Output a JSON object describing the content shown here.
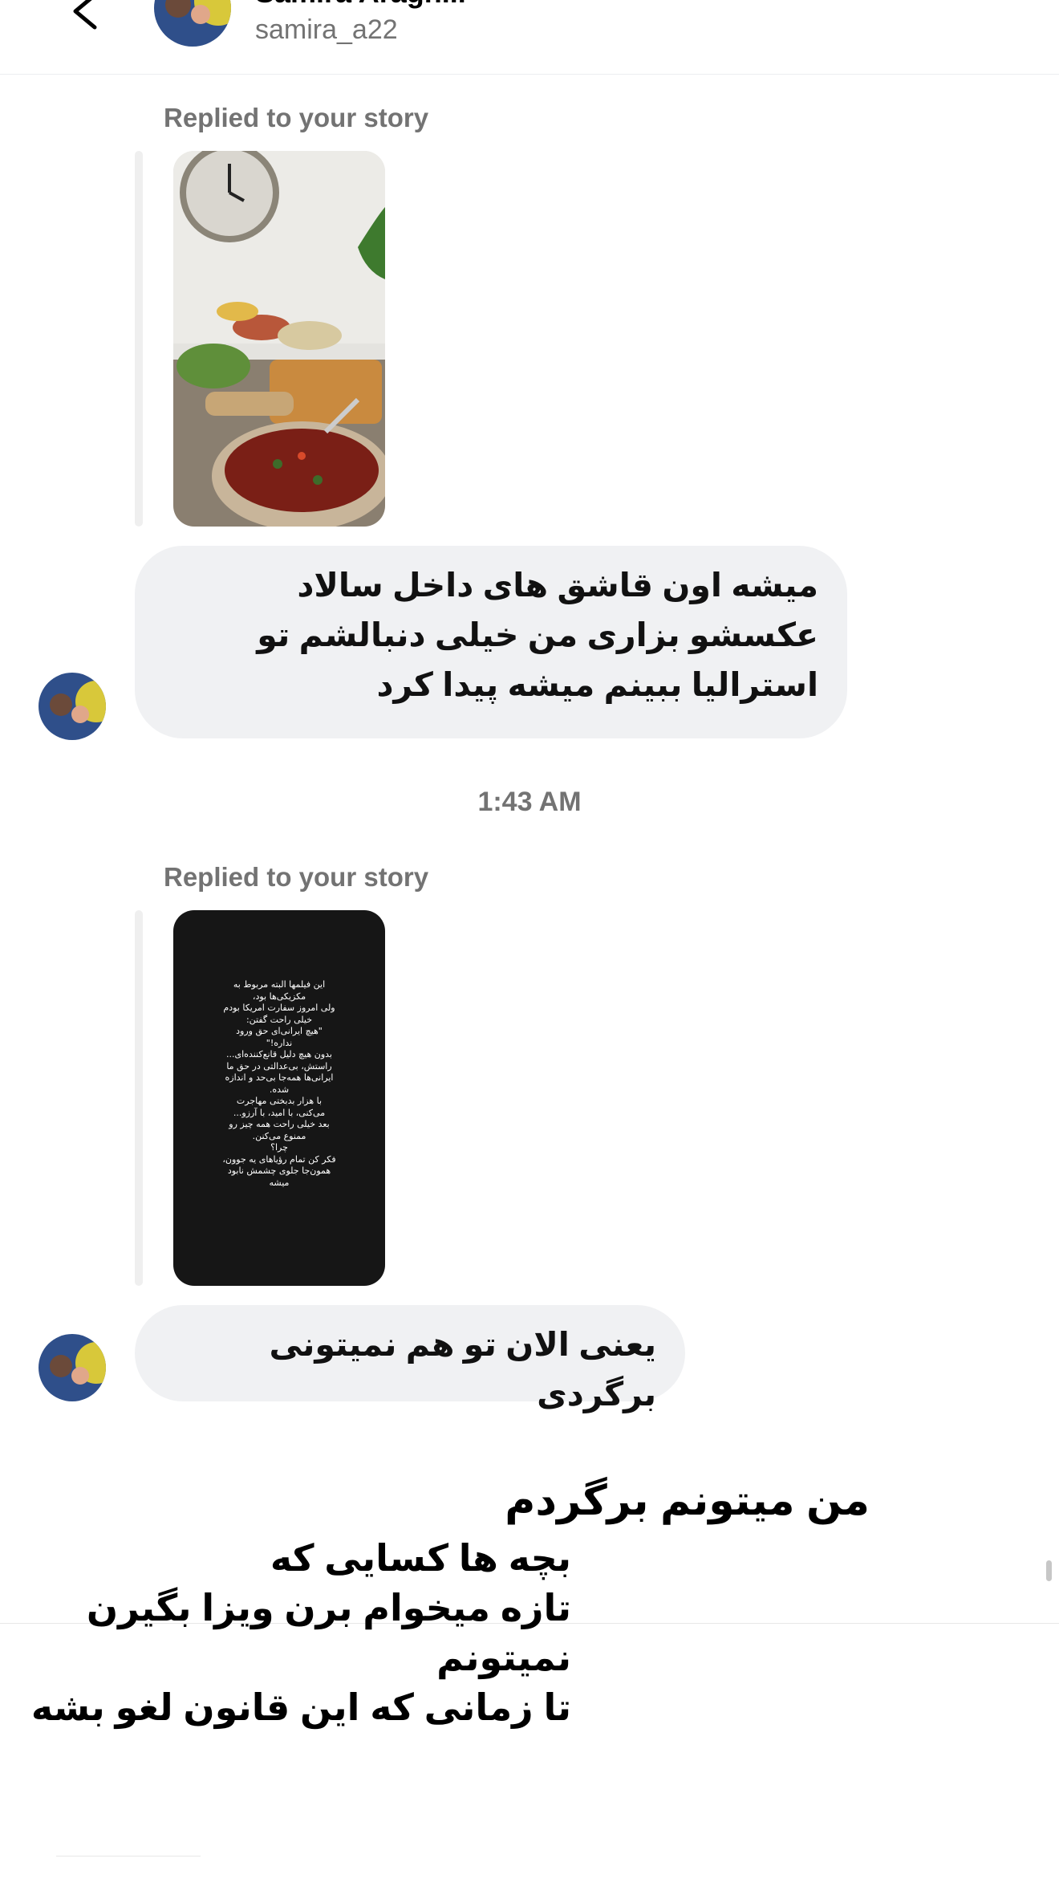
{
  "header": {
    "name": "Samira Aragh...",
    "username": "samira_a22"
  },
  "messages": [
    {
      "replied_label": "Replied to your story",
      "text": "میشه اون قاشق های داخل سالاد عکسشو بزاری من خیلی دنبالشم تو استرالیا ببینم میشه پیدا کرد"
    },
    {
      "replied_label": "Replied to your story",
      "text": "یعنی الان تو هم نمیتونی برگردی"
    }
  ],
  "timestamp": "1:43 AM",
  "story2_text": [
    "این فیلمها البته مربوط به",
    "مکزیکی‌ها بود،",
    "ولی امروز سفارت امریکا بودم",
    "خیلی راحت گفتن:",
    "\"هیچ ایرانی‌ای حق ورود",
    "نداره!\"",
    "بدون هیچ دلیل قانع‌کننده‌ای...",
    "راستش، بی‌عدالتی در حق ما",
    "ایرانی‌ها همه‌جا بی‌حد و اندازه",
    "شده.",
    "با هزار بدبختی مهاجرت",
    "می‌کنی، با امید، با آرزو...",
    "بعد خیلی راحت همه چیز رو",
    "ممنوع می‌کنن.",
    "چرا؟",
    "فکر کن تمام رؤیاهای یه جوون،",
    "همون‌جا جلوی چشمش نابود",
    "میشه"
  ],
  "composer": {
    "line1": "من میتونم برگردم",
    "lines": [
      "بچه ها کسایی که",
      "تازه میخوام برن ویزا بگیرن",
      "نمیتونم",
      "تا زمانی که این قانون لغو بشه"
    ]
  }
}
